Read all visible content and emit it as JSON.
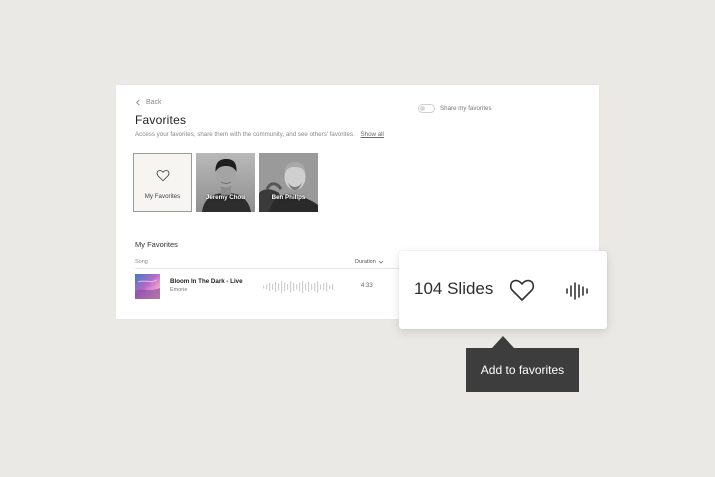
{
  "nav": {
    "back_label": "Back"
  },
  "header": {
    "title": "Favorites",
    "description": "Access your favorites, share them with the community, and see others' favorites.",
    "show_all": "Show all",
    "share_toggle_label": "Share my favorites",
    "share_toggle_on": false
  },
  "collections": [
    {
      "label": "My Favorites"
    },
    {
      "label": "Jeremy Chou"
    },
    {
      "label": "Ben Philips"
    }
  ],
  "favorites_list": {
    "section_title": "My Favorites",
    "columns": {
      "song": "Song",
      "duration": "Duration"
    },
    "rows": [
      {
        "song": "Bloom In The Dark - Live",
        "artist": "Emorie",
        "duration": "4:33"
      }
    ]
  },
  "popup": {
    "slides_label": "104 Slides",
    "heart_icon": "heart-outline-icon",
    "audio_icon": "audio-waveform-icon"
  },
  "tooltip": {
    "text": "Add to favorites"
  },
  "colors": {
    "background": "#ebe9e5",
    "panel": "#ffffff",
    "tooltip_bg": "#3d3d3d",
    "accent_text": "#2b2b2b"
  }
}
